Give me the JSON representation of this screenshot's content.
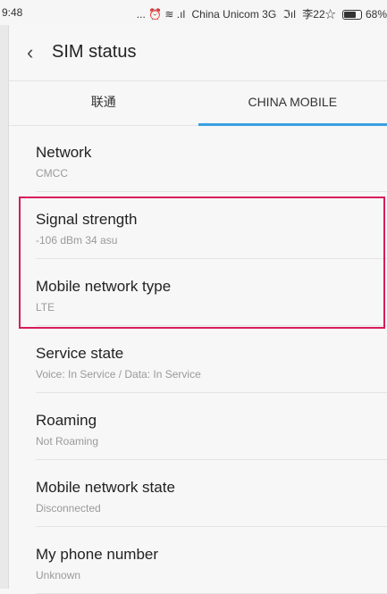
{
  "statusbar": {
    "time": "9:48",
    "indicators": "... ⏰ ≋ .ıl",
    "carrier": "China Unicom 3G",
    "signal2": "ℑıl",
    "misc": "李22☆",
    "battery_percent": "68%"
  },
  "header": {
    "back_icon": "chevron-left-icon",
    "title": "SIM status"
  },
  "tabs": [
    {
      "label": "联通",
      "active": false
    },
    {
      "label": "CHINA MOBILE",
      "active": true
    }
  ],
  "items": [
    {
      "label": "Network",
      "value": "CMCC"
    },
    {
      "label": "Signal strength",
      "value": "-106 dBm 34 asu"
    },
    {
      "label": "Mobile network type",
      "value": "LTE"
    },
    {
      "label": "Service state",
      "value": "Voice: In Service / Data: In Service"
    },
    {
      "label": "Roaming",
      "value": "Not Roaming"
    },
    {
      "label": "Mobile network state",
      "value": "Disconnected"
    },
    {
      "label": "My phone number",
      "value": "Unknown"
    }
  ],
  "colors": {
    "accent": "#3aa0e0",
    "highlight": "#d81b5c"
  }
}
